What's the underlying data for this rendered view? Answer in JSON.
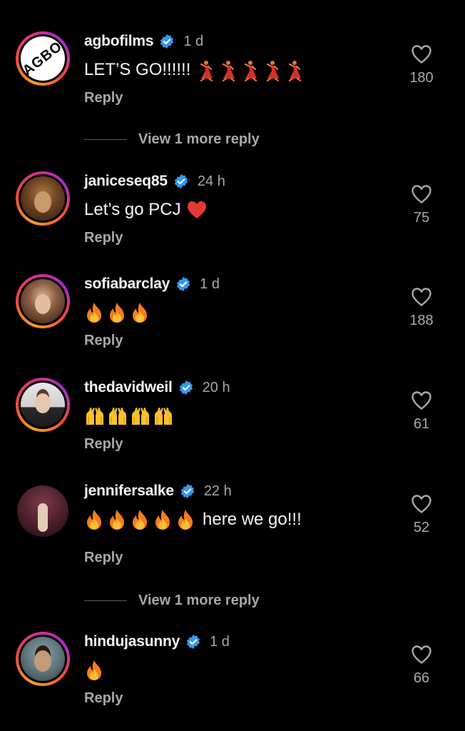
{
  "comments": [
    {
      "username": "agbofilms",
      "time": "1 d",
      "text": "LET’S GO!!!!!!",
      "emoji": "dancer",
      "emoji_count": 5,
      "likes": "180",
      "reply": "Reply",
      "avatar_text": "AGBO"
    },
    {
      "username": "janiceseq85",
      "time": "24 h",
      "text": "Let’s go PCJ",
      "emoji": "red-heart",
      "likes": "75",
      "reply": "Reply"
    },
    {
      "username": "sofiabarclay",
      "time": "1 d",
      "text": "",
      "emoji": "fire",
      "emoji_count": 3,
      "likes": "188",
      "reply": "Reply"
    },
    {
      "username": "thedavidweil",
      "time": "20 h",
      "text": "",
      "emoji": "raising-hands",
      "emoji_count": 4,
      "likes": "61",
      "reply": "Reply"
    },
    {
      "username": "jennifersalke",
      "time": "22 h",
      "text": "here we go!!!",
      "emoji": "fire",
      "emoji_count": 5,
      "likes": "52",
      "reply": "Reply"
    },
    {
      "username": "hindujasunny",
      "time": "1 d",
      "text": "",
      "emoji": "fire",
      "emoji_count": 1,
      "likes": "66",
      "reply": "Reply"
    }
  ],
  "more_replies": [
    "View 1 more reply",
    "View 1 more reply"
  ],
  "colors": {
    "verified": "#3797f0",
    "secondary_text": "#a8a8a8",
    "background": "#000000"
  }
}
